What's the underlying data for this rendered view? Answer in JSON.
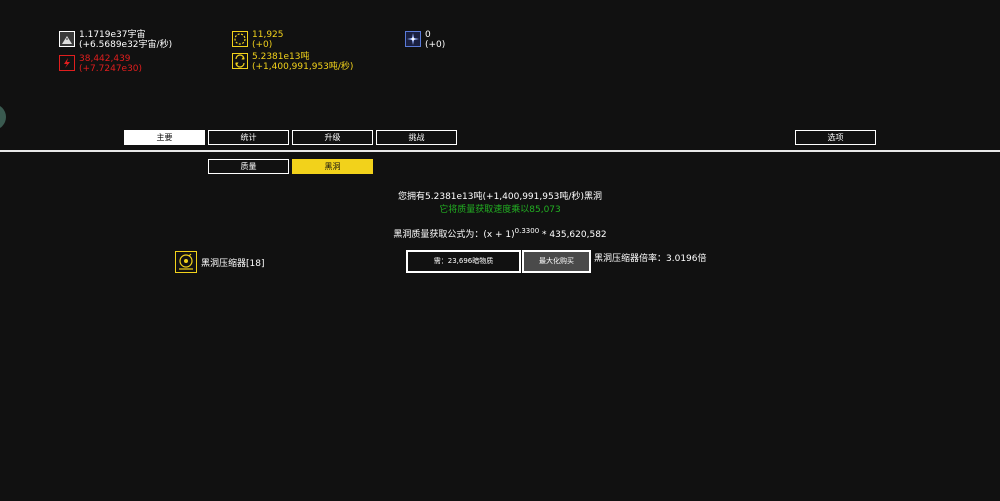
{
  "resources": {
    "universes": {
      "icon": "mountain-icon",
      "value": "1.1719e37宇宙",
      "rate": "(+6.5689e32宇宙/秒)",
      "color": "#ffffff"
    },
    "energy": {
      "icon": "lightning-icon",
      "value": "38,442,439",
      "rate": "(+7.7247e30)",
      "color": "#e01e1e"
    },
    "orbs": {
      "icon": "orb-ring-icon",
      "value": "11,925",
      "rate": "(+0)",
      "color": "#f2d21b"
    },
    "mass": {
      "icon": "cycle-arrows-icon",
      "value": "5.2381e13吨",
      "rate": "(+1,400,991,953吨/秒)",
      "color": "#f2d21b"
    },
    "stars": {
      "icon": "compass-star-icon",
      "value": "0",
      "rate": "(+0)",
      "color": "#ffffff"
    }
  },
  "nav": {
    "main": "主要",
    "stats": "统计",
    "upgrades": "升级",
    "challenges": "挑战",
    "options": "选项"
  },
  "subnav": {
    "mass": "质量",
    "blackhole": "黑洞"
  },
  "blackhole": {
    "owned_text": "您拥有5.2381e13吨(+1,400,991,953吨/秒)黑洞",
    "effect_text": "它将质量获取速度乘以85,073",
    "formula_prefix": "黑洞质量获取公式为：(x + 1)",
    "formula_exponent": "0.3300",
    "formula_suffix": " * 435,620,582"
  },
  "compressor": {
    "icon": "compressor-icon",
    "name": "黑洞压缩器[18]",
    "cost_label": "需：23,696暗物质",
    "max_buy_label": "最大化购买",
    "multiplier_text": "黑洞压缩器倍率：3.0196倍"
  }
}
